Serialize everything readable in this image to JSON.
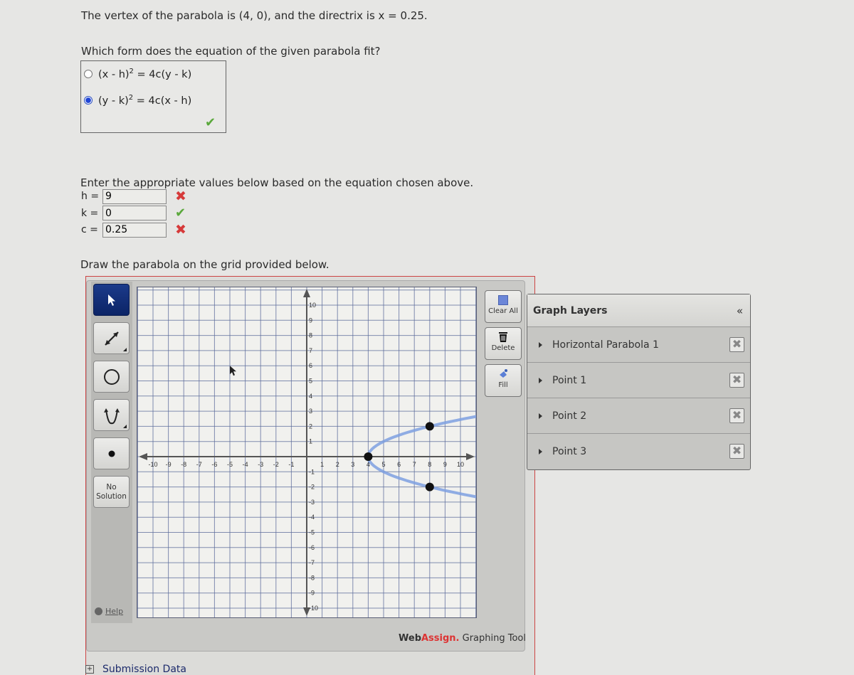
{
  "question": {
    "vertex_text": "The vertex of the parabola is (4, 0), and the directrix is x = 0.25.",
    "form_prompt": "Which form does the equation of the given parabola fit?",
    "options": [
      {
        "label_pre": "(x - h)",
        "sup": "2",
        "label_post": " = 4c(y - k)",
        "selected": false
      },
      {
        "label_pre": "(y - k)",
        "sup": "2",
        "label_post": " = 4c(x - h)",
        "selected": true
      }
    ],
    "form_status": "correct",
    "values_prompt": "Enter the appropriate values below based on the equation chosen above.",
    "fields": [
      {
        "label": "h =",
        "value": "9",
        "status": "incorrect"
      },
      {
        "label": "k =",
        "value": "0",
        "status": "correct"
      },
      {
        "label": "c =",
        "value": "0.25",
        "status": "incorrect"
      }
    ],
    "draw_prompt": "Draw the parabola on the grid provided below."
  },
  "status_glyphs": {
    "correct": "✔",
    "incorrect": "✖"
  },
  "tools": {
    "left": [
      "select",
      "line",
      "circle",
      "parabola",
      "point",
      "no-solution"
    ],
    "no_solution_line1": "No",
    "no_solution_line2": "Solution",
    "help_label": "Help",
    "clear_all_label": "Clear All",
    "delete_label": "Delete",
    "fill_label": "Fill"
  },
  "layers": {
    "title": "Graph Layers",
    "collapse_glyph": "«",
    "items": [
      {
        "name": "Horizontal Parabola 1"
      },
      {
        "name": "Point 1"
      },
      {
        "name": "Point 2"
      },
      {
        "name": "Point 3"
      }
    ],
    "delete_glyph": "✖"
  },
  "branding": {
    "web": "Web",
    "assign": "Assign.",
    "tool": " Graphing Tool"
  },
  "submission_data_label": "Submission Data",
  "chart_data": {
    "type": "scatter",
    "title": "",
    "xlabel": "",
    "ylabel": "",
    "xlim": [
      -10,
      10
    ],
    "ylim": [
      -10,
      10
    ],
    "grid": true,
    "x_ticks": [
      -10,
      -9,
      -8,
      -7,
      -6,
      -5,
      -4,
      -3,
      -2,
      -1,
      1,
      2,
      3,
      4,
      5,
      6,
      7,
      8,
      9,
      10
    ],
    "y_ticks": [
      10,
      9,
      8,
      7,
      6,
      5,
      4,
      3,
      2,
      1,
      -1,
      -2,
      -3,
      -4,
      -5,
      -6,
      -7,
      -8,
      -9,
      -10
    ],
    "parabola": {
      "orientation": "horizontal",
      "vertex": [
        4,
        0
      ],
      "passes_through": [
        8,
        2
      ],
      "color": "#7ea0e0"
    },
    "points": [
      {
        "name": "Point 1",
        "x": 4,
        "y": 0
      },
      {
        "name": "Point 2",
        "x": 8,
        "y": 2
      },
      {
        "name": "Point 3",
        "x": 8,
        "y": -2
      }
    ],
    "cursor": {
      "x": -5,
      "y": 6
    }
  }
}
